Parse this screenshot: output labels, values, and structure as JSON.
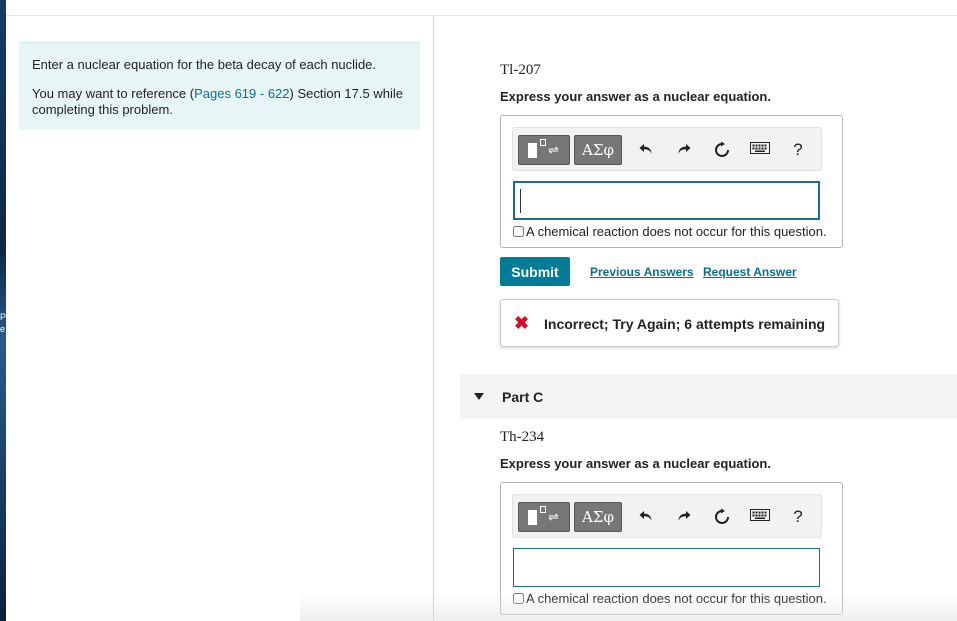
{
  "intro": {
    "instruction": "Enter a nuclear equation for the beta decay of each nuclide.",
    "reference_prefix": "You may want to reference (",
    "reference_link": "Pages 619 - 622",
    "reference_suffix": ") Section 17.5 while completing this problem."
  },
  "part_b": {
    "nuclide": "Tl-207",
    "instruction": "Express your answer as a nuclear equation.",
    "no_reaction_label": "A chemical reaction does not occur for this question.",
    "submit_label": "Submit",
    "previous_answers_label": "Previous Answers",
    "request_answer_label": "Request Answer",
    "feedback_icon": "✖",
    "feedback_text": "Incorrect; Try Again; 6 attempts remaining"
  },
  "part_c": {
    "label": "Part C",
    "nuclide": "Th-234",
    "instruction": "Express your answer as a nuclear equation.",
    "no_reaction_label": "A chemical reaction does not occur for this question."
  },
  "toolbar": {
    "greek_label": "ΑΣφ",
    "help_label": "?",
    "icons": [
      "templates-icon",
      "greek-letters-icon",
      "undo-icon",
      "redo-icon",
      "reset-icon",
      "keyboard-icon",
      "help-icon"
    ]
  },
  "colors": {
    "accent": "#007c99",
    "link": "#0a6f8f",
    "error": "#d0102a",
    "intro_bg": "#e8f5f5"
  }
}
